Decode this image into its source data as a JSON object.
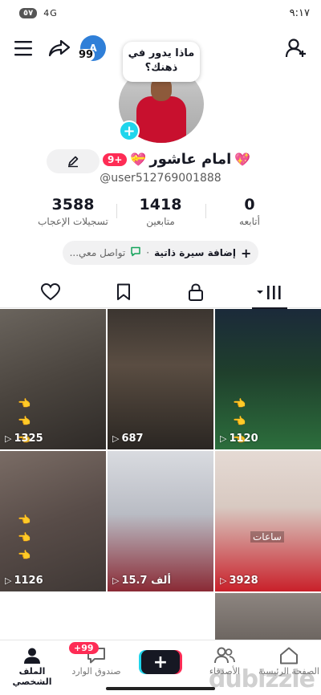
{
  "status_bar": {
    "time": "٩:١٧",
    "battery": "٥٧",
    "signal": "4G"
  },
  "header": {
    "story_count": "99",
    "story_letter": "A"
  },
  "profile": {
    "bubble_text": "ماذا يدور في ذهنك؟",
    "name": "امام عاشور",
    "badge": "+9",
    "username": "@user512769001888"
  },
  "stats": [
    {
      "value": "3588",
      "label": "تسجيلات الإعجاب"
    },
    {
      "value": "1418",
      "label": "متابعين"
    },
    {
      "value": "0",
      "label": "أتابعه"
    }
  ],
  "bio": {
    "add_label": "إضافة سيرة ذاتية",
    "separator": "·",
    "contact_label": "تواصل معي..."
  },
  "tabs": [
    "liked-heart",
    "saved-bookmark",
    "private-lock",
    "videos-grid"
  ],
  "videos": [
    {
      "views": "1325"
    },
    {
      "views": "687"
    },
    {
      "views": "1120"
    },
    {
      "views": "1126"
    },
    {
      "views": "15.7 ألف"
    },
    {
      "views": "3928",
      "caption": "ساعات"
    }
  ],
  "bottom_nav": {
    "profile": "الملف الشخصي",
    "inbox": "صندوق الوارد",
    "inbox_badge": "+99",
    "friends": "الأصدقاء",
    "home": "الصفحة الرئيسية"
  },
  "watermark": "dubizzle",
  "colors": {
    "accent_red": "#fe2c55",
    "accent_cyan": "#20d5ec"
  }
}
